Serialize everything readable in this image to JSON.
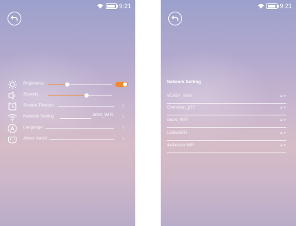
{
  "status": {
    "time": "9:21",
    "battery_level": 0.85
  },
  "settings": {
    "items": [
      {
        "label": "Brightness",
        "icon": "sun-icon",
        "slider": 0.3,
        "toggle": true
      },
      {
        "label": "Sounds",
        "icon": "speaker-icon",
        "slider": 0.6
      },
      {
        "label": "Screen Timeout",
        "icon": "alarm-clock-icon"
      },
      {
        "label": "Network Setting",
        "icon": "wifi-icon",
        "value": "WAN_WIFI"
      },
      {
        "label": "Language",
        "icon": "letter-a-icon"
      },
      {
        "label": "About xiaoxi",
        "icon": "robot-icon"
      }
    ]
  },
  "network": {
    "title": "Network Setting",
    "items": [
      {
        "name": "VEASY_mimi"
      },
      {
        "name": "Chenshan_p37"
      },
      {
        "name": "xiaoxi_WiFi"
      },
      {
        "name": "LeBaoWiFi"
      },
      {
        "name": "dadasoon WiFi"
      }
    ]
  },
  "colors": {
    "accent": "#f08a2e"
  }
}
